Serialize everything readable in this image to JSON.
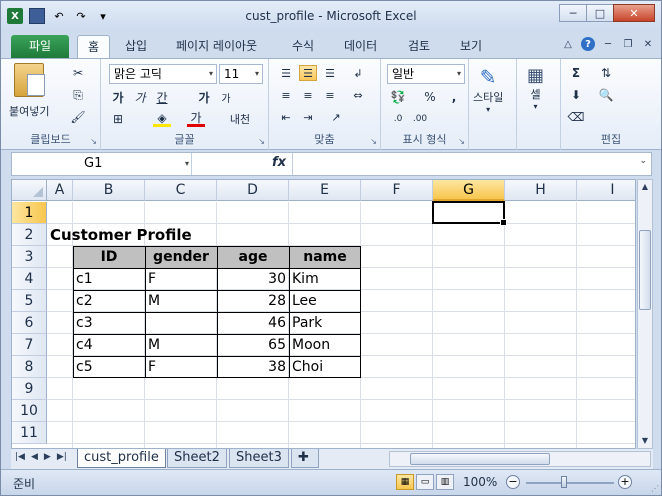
{
  "app": {
    "title": "cust_profile  -  Microsoft Excel",
    "window_buttons": {
      "minimize": "─",
      "maximize": "□",
      "close": "✕"
    }
  },
  "qat": {
    "logo": "X",
    "undo": "↶",
    "redo": "↷",
    "more": "▾"
  },
  "tabs": [
    {
      "label": "파일"
    },
    {
      "label": "홈"
    },
    {
      "label": "삽입"
    },
    {
      "label": "페이지 레이아웃"
    },
    {
      "label": "수식"
    },
    {
      "label": "데이터"
    },
    {
      "label": "검토"
    },
    {
      "label": "보기"
    }
  ],
  "ribbon": {
    "clipboard": {
      "label": "클립보드",
      "paste": "붙여넣기"
    },
    "font": {
      "label": "글꼴",
      "name": "맑은 고딕",
      "size": "11",
      "bold": "가",
      "italic": "가",
      "underline": "간",
      "grow": "가",
      "shrink": "가",
      "fontcolor": "가",
      "phonetic": "내천"
    },
    "alignment": {
      "label": "맞춤"
    },
    "number": {
      "label": "표시 형식",
      "format": "일반",
      "percent": "%",
      "comma": ","
    },
    "styles": {
      "label": "스타일",
      "cell": "셀"
    },
    "cells": {
      "label": "셀"
    },
    "editing": {
      "label": "편집",
      "sum": "Σ"
    }
  },
  "formula_bar": {
    "name_box": "G1",
    "fx": "fx",
    "value": ""
  },
  "sheet": {
    "columns": [
      "A",
      "B",
      "C",
      "D",
      "E",
      "F",
      "G",
      "H",
      "I"
    ],
    "rows": [
      "1",
      "2",
      "3",
      "4",
      "5",
      "6",
      "7",
      "8",
      "9",
      "10",
      "11"
    ],
    "selected_cell": "G1",
    "title": "Customer Profile",
    "headers": [
      "ID",
      "gender",
      "age",
      "name"
    ],
    "data": [
      [
        "c1",
        "F",
        "30",
        "Kim"
      ],
      [
        "c2",
        "M",
        "28",
        "Lee"
      ],
      [
        "c3",
        "",
        "46",
        "Park"
      ],
      [
        "c4",
        "M",
        "65",
        "Moon"
      ],
      [
        "c5",
        "F",
        "38",
        "Choi"
      ]
    ]
  },
  "sheet_tabs": [
    "cust_profile",
    "Sheet2",
    "Sheet3"
  ],
  "status": {
    "text": "준비",
    "zoom": "100%"
  },
  "colors": {
    "file_tab": "#1f7a3a",
    "header_fill": "#c0c0c0",
    "active_header": "#f7c64e"
  }
}
